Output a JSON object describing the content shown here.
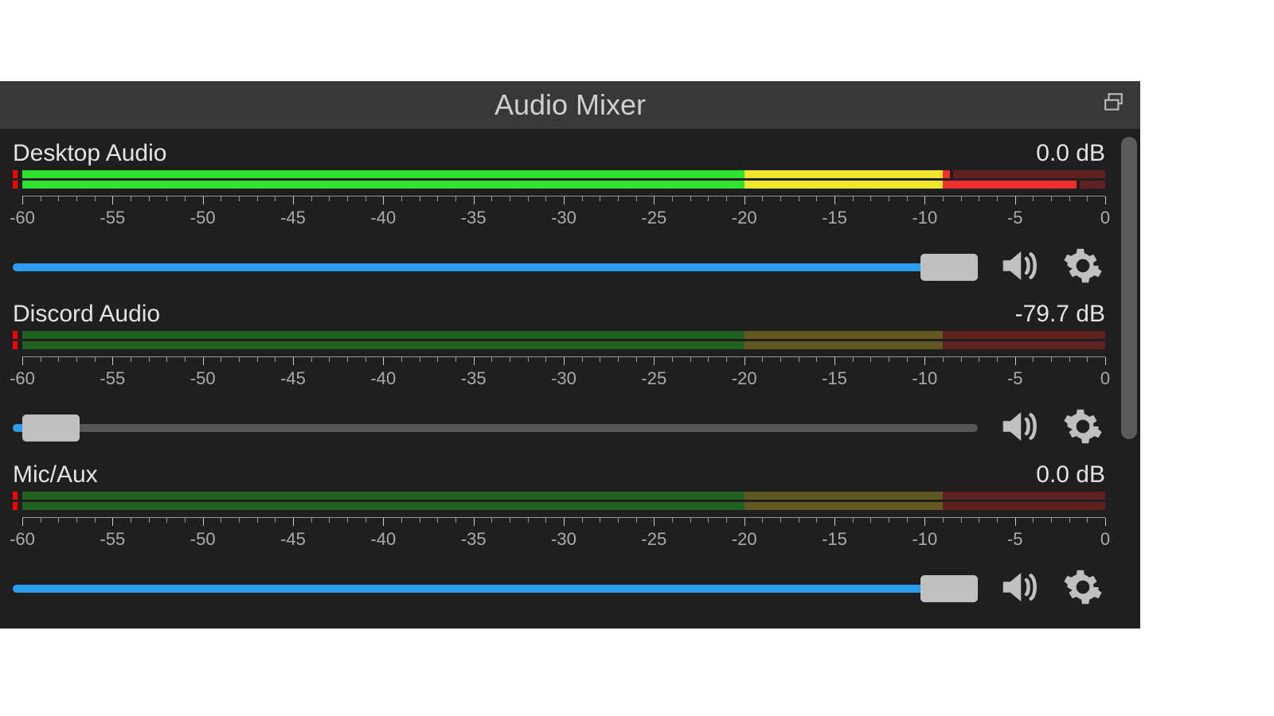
{
  "panel": {
    "title": "Audio Mixer",
    "dock_icon": "dock-window"
  },
  "scale": {
    "min_db": -60,
    "max_db": 0,
    "labels": [
      "-60",
      "-55",
      "-50",
      "-45",
      "-40",
      "-35",
      "-30",
      "-25",
      "-20",
      "-15",
      "-10",
      "-5",
      "0"
    ]
  },
  "meter": {
    "green_end_db": -20,
    "yellow_end_db": -9
  },
  "channels": [
    {
      "name": "Desktop Audio",
      "level_text": "0.0 dB",
      "slider_pct": 97,
      "meter_top_db": -8.5,
      "meter_bot_db": -1.5,
      "clip": true
    },
    {
      "name": "Discord Audio",
      "level_text": "-79.7 dB",
      "slider_pct": 4,
      "meter_top_db": -999,
      "meter_bot_db": -999,
      "clip": true
    },
    {
      "name": "Mic/Aux",
      "level_text": "0.0 dB",
      "slider_pct": 97,
      "meter_top_db": -999,
      "meter_bot_db": -999,
      "clip": true
    }
  ],
  "icons": {
    "speaker": "speaker-icon",
    "gear": "gear-icon"
  }
}
